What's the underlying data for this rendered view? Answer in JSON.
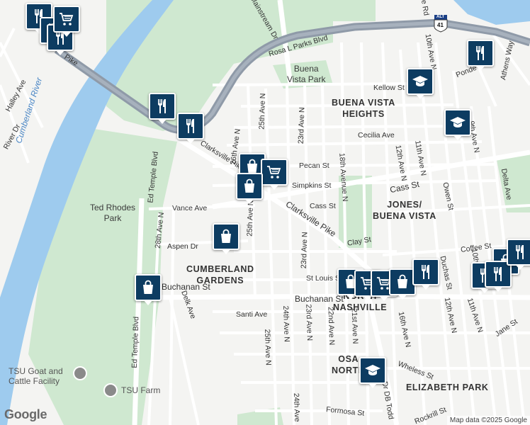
{
  "map": {
    "colors": {
      "land": "#f4f4f2",
      "park": "#cfe8d0",
      "water": "#9ecbee",
      "highway": "#8f9aa8",
      "road": "#ffffff",
      "marker_bg": "#0d3c61",
      "marker_border": "#ffffff"
    },
    "road_labels": {
      "rosa_parks": "Rosa L Parks Blvd",
      "mainstream": "Mainstream Dr",
      "kellow": "Kellow St",
      "pike_top": "Pike",
      "ave_25_top": "25th Ave N",
      "ave_26": "26th Ave N",
      "ave_23_top": "23rd Ave N",
      "ave_18": "18th Avenue N",
      "ave_12_top": "12th Ave N",
      "ave_11_top": "11th Ave N",
      "ave_10_top": "10th Ave N",
      "ave_9": "9th Ave N",
      "pecan": "Pecan St",
      "simpkins": "Simpkins St",
      "cass_1": "Cass St",
      "cass_2": "Cass St",
      "cecilia": "Cecilia Ave",
      "clarksville_1": "Clarksville Pike",
      "clarksville_2": "Clarksville Pike",
      "vance": "Vance Ave",
      "aspen": "Aspen Dr",
      "ave_25_mid": "25th Ave N",
      "ave_28": "28th Ave N",
      "ed_temple_1": "Ed Temple Blvd",
      "ed_temple_2": "Ed Temple Blvd",
      "buchanan_1": "Buchanan St",
      "buchanan_2": "Buchanan St",
      "st_louis": "St Louis St",
      "clay": "Clay St",
      "coffee": "Coffee St",
      "santi": "Santi Ave",
      "delk": "Delk Ave",
      "ave_24_1": "24th Ave N",
      "ave_25_bot": "25th Ave N",
      "ave_23_mid": "23rd Ave N",
      "ave_23_bot": "23rd Ave N",
      "ave_22": "22nd Ave N",
      "ave_21": "21st Ave N",
      "ave_16": "16th Ave N",
      "ave_12_bot": "12th Ave N",
      "ave_11_bot": "11th Ave N",
      "ave_10_bot": "10th",
      "wheless": "Wheless St",
      "jane": "Jane St",
      "owen": "Owen St",
      "delta": "Delta Ave",
      "athens": "Athens Way",
      "ponde": "Ponde",
      "halley": "Halley Ave",
      "river_dr": "River Dr",
      "cecilia_r": "Cecilia Ave",
      "formosa": "Formosa St",
      "ave_24_bot": "24th Ave",
      "db_todd": "Dr DB Todd",
      "rockrill": "Rockrill St",
      "duchas": "Duchas St",
      "cle_rd": "cle Rd",
      "alt_route": "ALT",
      "route_41": "41"
    },
    "area_labels": {
      "buena_vista_heights_1": "BUENA VISTA",
      "buena_vista_heights_2": "HEIGHTS",
      "jones_buena_vista_1": "JONES/",
      "jones_buena_vista_2": "BUENA VISTA",
      "cumberland_gardens_1": "CUMBERLAND",
      "cumberland_gardens_2": "GARDENS",
      "north_nashville_1": "NORTH",
      "north_nashville_2": "NASHVILLE",
      "osage_north_1": "OSA",
      "osage_north_2": "NORTH",
      "elizabeth_park": "ELIZABETH PARK"
    },
    "park_labels": {
      "buena_vista_park_1": "Buena",
      "buena_vista_park_2": "Vista Park",
      "ted_rhodes_1": "Ted Rhodes",
      "ted_rhodes_2": "Park"
    },
    "water_labels": {
      "cumberland_river": "Cumberland River"
    },
    "poi_labels": {
      "tsu_goat_1": "TSU Goat and",
      "tsu_goat_2": "Cattle Facility",
      "tsu_farm": "TSU Farm"
    },
    "markers": [
      {
        "type": "restaurant",
        "icon": "fork-knife-icon"
      },
      {
        "type": "restaurant",
        "icon": "fork-knife-icon"
      },
      {
        "type": "restaurant",
        "icon": "fork-knife-icon"
      },
      {
        "type": "restaurant",
        "icon": "fork-knife-icon"
      },
      {
        "type": "restaurant",
        "icon": "fork-knife-icon"
      },
      {
        "type": "restaurant",
        "icon": "fork-knife-icon"
      },
      {
        "type": "grocery",
        "icon": "shopping-cart-icon"
      },
      {
        "type": "school",
        "icon": "graduation-cap-icon"
      },
      {
        "type": "school",
        "icon": "graduation-cap-icon"
      },
      {
        "type": "shopping",
        "icon": "shopping-bag-icon"
      },
      {
        "type": "grocery",
        "icon": "shopping-cart-icon"
      },
      {
        "type": "shopping",
        "icon": "shopping-bag-icon"
      },
      {
        "type": "shopping",
        "icon": "shopping-bag-icon"
      },
      {
        "type": "shopping",
        "icon": "shopping-bag-icon"
      },
      {
        "type": "shopping",
        "icon": "shopping-bag-icon"
      },
      {
        "type": "grocery",
        "icon": "shopping-cart-icon"
      },
      {
        "type": "grocery",
        "icon": "shopping-cart-icon"
      },
      {
        "type": "shopping",
        "icon": "shopping-bag-icon"
      },
      {
        "type": "restaurant",
        "icon": "fork-knife-icon"
      },
      {
        "type": "restaurant",
        "icon": "fork-knife-icon"
      },
      {
        "type": "shopping",
        "icon": "shopping-bag-icon"
      },
      {
        "type": "restaurant",
        "icon": "fork-knife-icon"
      },
      {
        "type": "restaurant",
        "icon": "fork-knife-icon"
      },
      {
        "type": "school",
        "icon": "graduation-cap-icon"
      }
    ],
    "logo": "Google",
    "attribution": "Map data ©2025 Google"
  }
}
